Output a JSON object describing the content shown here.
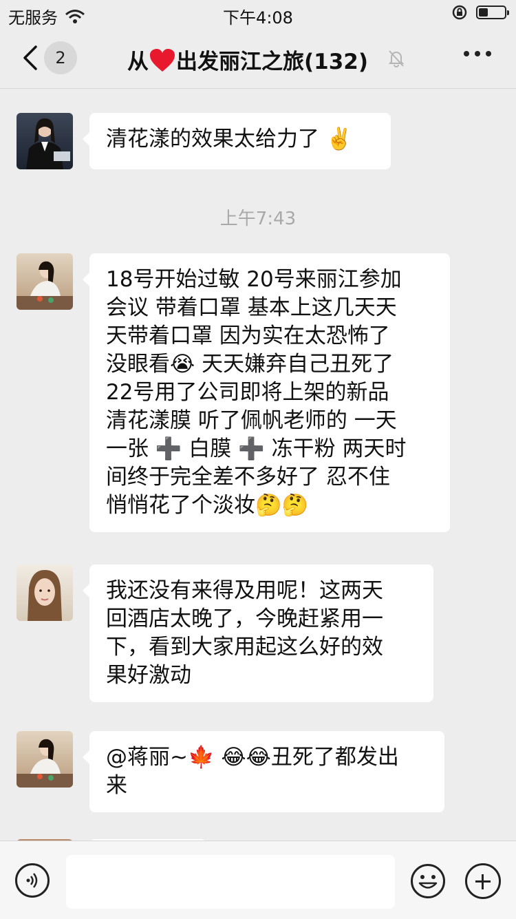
{
  "status_bar": {
    "carrier": "无服务",
    "time": "下午4:08",
    "battery_level": 0.35
  },
  "header": {
    "back_count": "2",
    "title_prefix": "从",
    "title_suffix": "出发丽江之旅(132)",
    "icons": [
      "chevron-left-icon",
      "heart-icon",
      "mute-bell-icon",
      "more-icon"
    ]
  },
  "messages": [
    {
      "lines": [
        "清花漾的效果太给力了 ✌️"
      ]
    },
    {
      "lines": [
        "18号开始过敏  20号来丽江参加",
        "会议 带着口罩 基本上这几天天",
        "天带着口罩 因为实在太恐怖了",
        "没眼看😭 天天嫌弃自己丑死了",
        "22号用了公司即将上架的新品",
        "清花漾膜 听了佩帆老师的 一天",
        "一张 ➕ 白膜 ➕ 冻干粉 两天时",
        "间终于完全差不多好了 忍不住",
        "悄悄花了个淡妆🤔🤔"
      ]
    },
    {
      "lines": [
        "我还没有来得及用呢！这两天",
        "回酒店太晚了，今晚赶紧用一",
        "下，看到大家用起这么好的效",
        "果好激动"
      ]
    },
    {
      "lines": [
        "@蒋丽~🍁 😂😂丑死了都发出",
        "来"
      ]
    }
  ],
  "timestamp": "上午7:43",
  "colors": {
    "background": "#ededed",
    "bubble": "#ffffff",
    "heart": "#e8192c",
    "timestamp": "#a9a9a9"
  }
}
